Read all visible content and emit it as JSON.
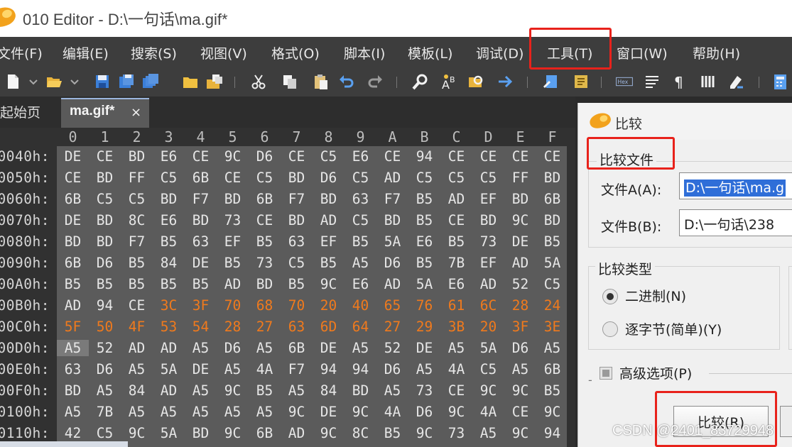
{
  "window": {
    "title": "010 Editor - D:\\一句话\\ma.gif*"
  },
  "menu": {
    "items": [
      {
        "label": "文件(F)",
        "key": "file"
      },
      {
        "label": "编辑(E)",
        "key": "edit"
      },
      {
        "label": "搜索(S)",
        "key": "search"
      },
      {
        "label": "视图(V)",
        "key": "view"
      },
      {
        "label": "格式(O)",
        "key": "format"
      },
      {
        "label": "脚本(I)",
        "key": "script"
      },
      {
        "label": "模板(L)",
        "key": "template"
      },
      {
        "label": "调试(D)",
        "key": "debug"
      },
      {
        "label": "工具(T)",
        "key": "tools"
      },
      {
        "label": "窗口(W)",
        "key": "window"
      },
      {
        "label": "帮助(H)",
        "key": "help"
      }
    ]
  },
  "toolbar": {
    "icons": [
      "new-file-icon",
      "open-folder-icon",
      "save-icon",
      "save-as-icon",
      "save-all-icon",
      "folder-icon",
      "open-multiple-icon",
      "cut-icon",
      "copy-icon",
      "paste-icon",
      "undo-icon",
      "redo-icon",
      "find-icon",
      "replace-icon",
      "find-in-files-icon",
      "goto-icon",
      "script-icon",
      "template-icon",
      "hex-view-icon",
      "text-view-icon",
      "pilcrow-icon",
      "columns-icon",
      "highlight-icon",
      "calculator-icon"
    ],
    "hex_label": "Hex"
  },
  "tabs": {
    "start": "起始页",
    "current": "ma.gif*",
    "close": "×"
  },
  "hex": {
    "columns": [
      "0",
      "1",
      "2",
      "3",
      "4",
      "5",
      "6",
      "7",
      "8",
      "9",
      "A",
      "B",
      "C",
      "D",
      "E",
      "F"
    ],
    "rows": [
      {
        "addr": "0040h:",
        "bytes": [
          "DE",
          "CE",
          "BD",
          "E6",
          "CE",
          "9C",
          "D6",
          "CE",
          "C5",
          "E6",
          "CE",
          "94",
          "CE",
          "CE",
          "CE",
          "CE"
        ]
      },
      {
        "addr": "0050h:",
        "bytes": [
          "CE",
          "BD",
          "FF",
          "C5",
          "6B",
          "CE",
          "C5",
          "BD",
          "D6",
          "C5",
          "AD",
          "C5",
          "C5",
          "C5",
          "FF",
          "BD"
        ]
      },
      {
        "addr": "0060h:",
        "bytes": [
          "6B",
          "C5",
          "C5",
          "BD",
          "F7",
          "BD",
          "6B",
          "F7",
          "BD",
          "63",
          "F7",
          "B5",
          "AD",
          "EF",
          "BD",
          "6B"
        ]
      },
      {
        "addr": "0070h:",
        "bytes": [
          "DE",
          "BD",
          "8C",
          "E6",
          "BD",
          "73",
          "CE",
          "BD",
          "AD",
          "C5",
          "BD",
          "B5",
          "CE",
          "BD",
          "9C",
          "BD"
        ]
      },
      {
        "addr": "0080h:",
        "bytes": [
          "BD",
          "BD",
          "F7",
          "B5",
          "63",
          "EF",
          "B5",
          "63",
          "EF",
          "B5",
          "5A",
          "E6",
          "B5",
          "73",
          "DE",
          "B5"
        ]
      },
      {
        "addr": "0090h:",
        "bytes": [
          "6B",
          "D6",
          "B5",
          "84",
          "DE",
          "B5",
          "73",
          "C5",
          "B5",
          "A5",
          "D6",
          "B5",
          "7B",
          "EF",
          "AD",
          "5A"
        ]
      },
      {
        "addr": "00A0h:",
        "bytes": [
          "B5",
          "B5",
          "B5",
          "B5",
          "B5",
          "AD",
          "BD",
          "B5",
          "9C",
          "E6",
          "AD",
          "5A",
          "E6",
          "AD",
          "52",
          "C5"
        ]
      },
      {
        "addr": "00B0h:",
        "bytes": [
          "AD",
          "94",
          "CE",
          "3C",
          "3F",
          "70",
          "68",
          "70",
          "20",
          "40",
          "65",
          "76",
          "61",
          "6C",
          "28",
          "24"
        ],
        "hl_from": 3
      },
      {
        "addr": "00C0h:",
        "bytes": [
          "5F",
          "50",
          "4F",
          "53",
          "54",
          "28",
          "27",
          "63",
          "6D",
          "64",
          "27",
          "29",
          "3B",
          "20",
          "3F",
          "3E"
        ],
        "hl_from": 0
      },
      {
        "addr": "00D0h:",
        "bytes": [
          "A5",
          "52",
          "AD",
          "AD",
          "A5",
          "D6",
          "A5",
          "6B",
          "DE",
          "A5",
          "52",
          "DE",
          "A5",
          "5A",
          "D6",
          "A5"
        ],
        "cursor": 0
      },
      {
        "addr": "00E0h:",
        "bytes": [
          "63",
          "D6",
          "A5",
          "5A",
          "DE",
          "A5",
          "4A",
          "F7",
          "94",
          "94",
          "D6",
          "A5",
          "4A",
          "C5",
          "A5",
          "6B"
        ]
      },
      {
        "addr": "00F0h:",
        "bytes": [
          "BD",
          "A5",
          "84",
          "AD",
          "A5",
          "9C",
          "B5",
          "A5",
          "84",
          "BD",
          "A5",
          "73",
          "CE",
          "9C",
          "9C",
          "B5"
        ]
      },
      {
        "addr": "0100h:",
        "bytes": [
          "A5",
          "7B",
          "A5",
          "A5",
          "A5",
          "A5",
          "A5",
          "9C",
          "DE",
          "9C",
          "4A",
          "D6",
          "9C",
          "4A",
          "CE",
          "9C"
        ]
      },
      {
        "addr": "0110h:",
        "bytes": [
          "42",
          "C5",
          "9C",
          "5A",
          "BD",
          "9C",
          "6B",
          "AD",
          "9C",
          "8C",
          "B5",
          "9C",
          "73",
          "A5",
          "9C",
          "94"
        ]
      }
    ],
    "colors": {
      "normal": "#e6e6e6",
      "highlight": "#f07a1d",
      "background": "#5b5b5b"
    }
  },
  "compare": {
    "title": "比较",
    "file_group": "比较文件",
    "file_a_label": "文件A(A):",
    "file_a_value": "D:\\一句话\\ma.g",
    "file_b_label": "文件B(B):",
    "file_b_value": "D:\\一句话\\238",
    "type_group": "比较类型",
    "binary_label": "二进制(N)",
    "bytewise_label": "逐字节(简单)(Y)",
    "advanced_label": "高级选项(P)",
    "compare_button": "比较(R)"
  },
  "watermark": "CSDN @2401_83729948",
  "annotation_color": "#e8221b"
}
